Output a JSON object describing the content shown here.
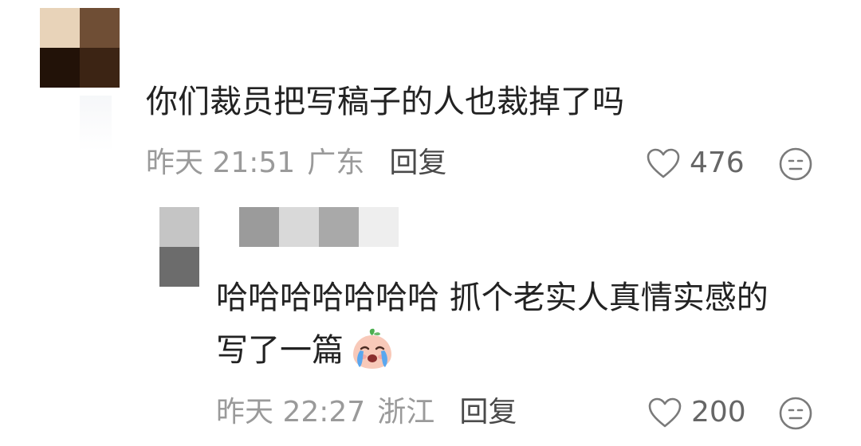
{
  "comment": {
    "text": "你们裁员把写稿子的人也裁掉了吗",
    "time": "昨天 21:51",
    "location": "广东",
    "reply_label": "回复",
    "like_count": "476",
    "avatar_icon": "pixelated-avatar",
    "like_icon": "heart-outline-icon",
    "reaction_icon": "neutral-face-icon",
    "avatar_colors": [
      "#e8d3b9",
      "#6f4e35",
      "#221208",
      "#3c2414"
    ]
  },
  "reply": {
    "text_line1": "哈哈哈哈哈哈哈 抓个老实人真情实感的",
    "text_line2": "写了一篇",
    "emoji_icon": "crying-peach-emoji",
    "time": "昨天 22:27",
    "location": "浙江",
    "reply_label": "回复",
    "like_count": "200",
    "avatar_icon": "pixelated-avatar",
    "like_icon": "heart-outline-icon",
    "reaction_icon": "neutral-face-icon",
    "avatar_colors": [
      "#c5c5c5",
      "#6c6c6c"
    ],
    "username_colors": [
      "#9b9b9b",
      "#d9d9d9",
      "#a9a9a9",
      "#eeeeee"
    ]
  }
}
